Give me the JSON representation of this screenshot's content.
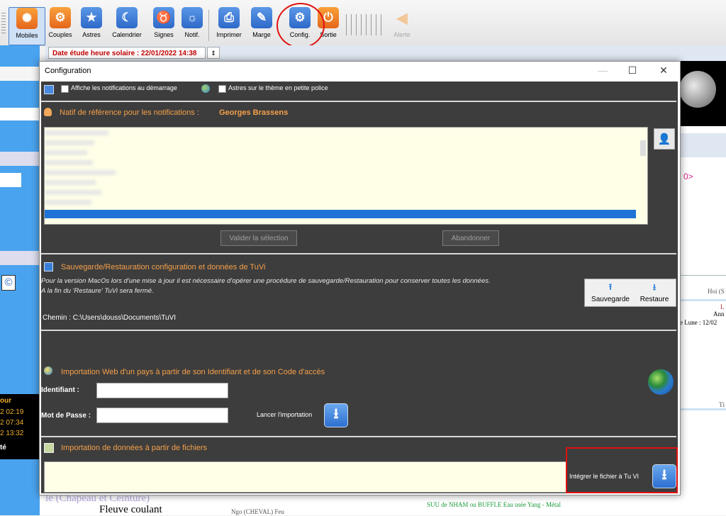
{
  "toolbar": {
    "buttons": [
      {
        "label": "Mobiles"
      },
      {
        "label": "Couples"
      },
      {
        "label": "Astres"
      },
      {
        "label": "Calendrier"
      },
      {
        "label": "Signes"
      },
      {
        "label": "Notif."
      },
      {
        "label": "Imprimer"
      },
      {
        "label": "Marge"
      },
      {
        "label": "Config."
      },
      {
        "label": "Sortie"
      },
      {
        "label": "Alerte"
      }
    ],
    "accent_color": "#2e69c9",
    "highlight_color": "#e01010"
  },
  "date_bar": {
    "label": "Date étude heure solaire : 22/01/2022 14:38"
  },
  "background": {
    "left_times": [
      "our",
      "2 02:19",
      "2 07:34",
      "2 13:32",
      "té"
    ],
    "right_texts": [
      "0>",
      "Hoi (S",
      "L",
      "Ann",
      "re Lune : 12/02",
      "Tì"
    ],
    "bottom_left": "le (Chapeau et Ceinture)",
    "bottom_left2": "Fleuve coulant",
    "bottom_mid": "Ngo (CHEVAL)  Feu",
    "bottom_right": "SUU de NHAM  ou  BUFFLE Eau usée   Yang - Métal"
  },
  "dialog": {
    "title": "Configuration",
    "options": {
      "notif_label": "Affiche les notifications au démarrage",
      "small_font_label": "Astres sur le thème en petite police"
    },
    "natif": {
      "label": "Natif de référence pour les notifications :",
      "name": "Georges Brassens"
    },
    "buttons": {
      "validate": "Valider la sélection",
      "cancel": "Abandonner"
    },
    "backup": {
      "title": "Sauvegarde/Restauration configuration et données de TuVi",
      "note_line1": "Pour la version MacOs lors d'une mise à jour il est nécessaire d'opérer une procédure de sauvegarde/Restauration pour conserver toutes les données.",
      "note_line2": "A la fin du 'Restaure' TuVi sera fermé.",
      "save_label": "Sauvegarde",
      "restore_label": "Restaure",
      "path_label": "Chemin : C:\\Users\\douss\\Documents\\TuVI"
    },
    "web_import": {
      "title": "Importation Web d'un pays à partir de son Identifiant et de son Code d'accès",
      "id_label": "Identifiant :",
      "password_label": "Mot de Passe :",
      "launch_label": "Lancer l'importation"
    },
    "file_import": {
      "title": "Importation de données à partir de fichiers",
      "integrate_label": "Intégrer le fichier à Tu VI"
    }
  }
}
